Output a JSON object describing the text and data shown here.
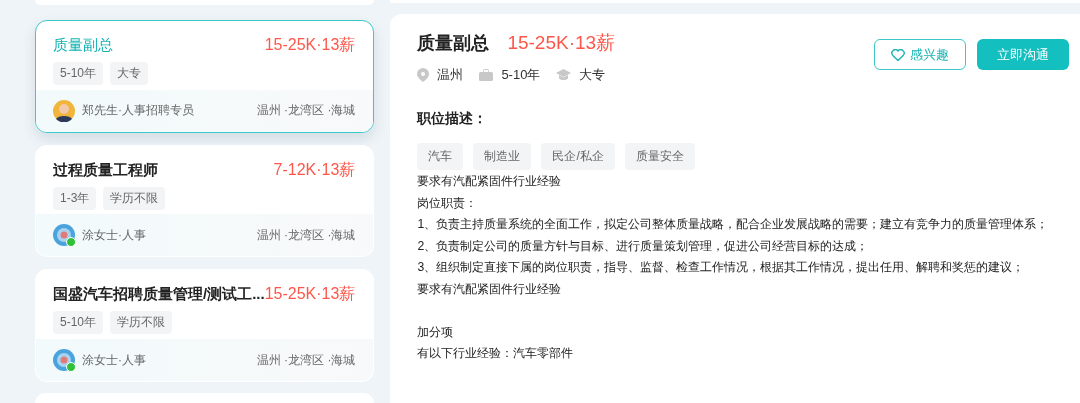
{
  "job_list": [
    {
      "title": "质量副总",
      "salary": "15-25K·13薪",
      "tags": [
        "5-10年",
        "大专"
      ],
      "recruiter": "郑先生·人事招聘专员",
      "avatar": {
        "kind": "person",
        "online": false
      },
      "location": "温州 ·龙湾区 ·海城",
      "selected": true
    },
    {
      "title": "过程质量工程师",
      "salary": "7-12K·13薪",
      "tags": [
        "1-3年",
        "学历不限"
      ],
      "recruiter": "涂女士·人事",
      "avatar": {
        "kind": "logo",
        "online": true
      },
      "location": "温州 ·龙湾区 ·海城",
      "selected": false
    },
    {
      "title": "国盛汽车招聘质量管理/测试工...",
      "salary": "15-25K·13薪",
      "tags": [
        "5-10年",
        "学历不限"
      ],
      "recruiter": "涂女士·人事",
      "avatar": {
        "kind": "logo",
        "online": true
      },
      "location": "温州 ·龙湾区 ·海城",
      "selected": false
    }
  ],
  "detail": {
    "title": "质量副总",
    "salary": "15-25K·13薪",
    "meta": [
      {
        "kind": "location",
        "text": "温州"
      },
      {
        "kind": "experience",
        "text": "5-10年"
      },
      {
        "kind": "education",
        "text": "大专"
      }
    ],
    "interest_button": "感兴趣",
    "chat_button": "立即沟通",
    "section_title": "职位描述：",
    "tags": [
      "汽车",
      "制造业",
      "民企/私企",
      "质量安全"
    ],
    "description": [
      [
        "要求有汽配紧固件行业经验",
        "岗位职责：",
        "1、负责主持质量系统的全面工作，拟定公司整体质量战略，配合企业发展战略的需要；建立有竞争力的质量管理体系；",
        "2、负责制定公司的质量方针与目标、进行质量策划管理，促进公司经营目标的达成；",
        "3、组织制定直接下属的岗位职责，指导、监督、检查工作情况，根据其工作情况，提出任用、解聘和奖惩的建议；",
        "要求有汽配紧固件行业经验"
      ],
      [
        "加分项",
        "有以下行业经验：汽车零部件"
      ]
    ]
  }
}
